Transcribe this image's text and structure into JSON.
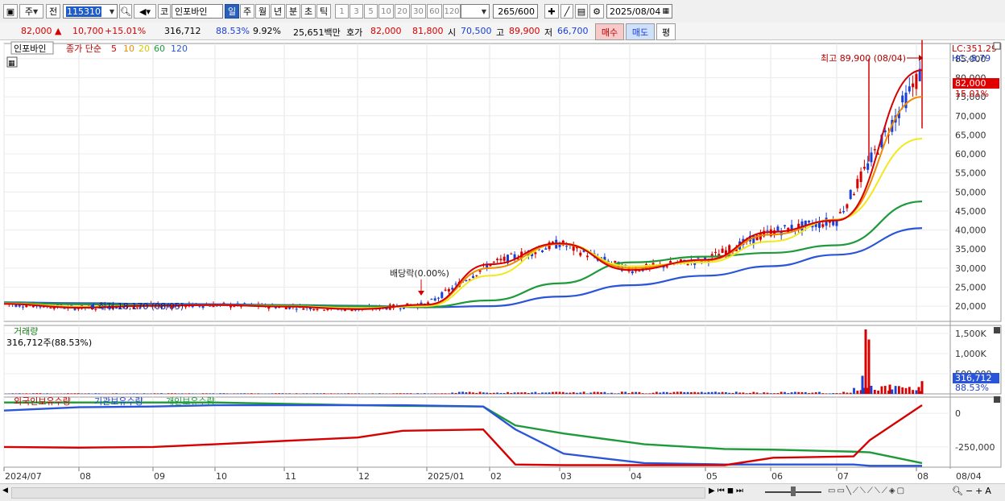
{
  "toolbar": {
    "market": "주",
    "prev": "전",
    "code": "115310",
    "market_type": "코",
    "stock_name": "인포바인",
    "period_tabs": [
      "일",
      "주",
      "월",
      "년",
      "분",
      "초",
      "틱"
    ],
    "active_period": "일",
    "intervals": [
      "1",
      "3",
      "5",
      "10",
      "20",
      "30",
      "60",
      "120"
    ],
    "count": "265",
    "count_total": "/600",
    "date": "2025/08/04"
  },
  "quote": {
    "price": "82,000",
    "change": "10,700",
    "change_pct": "+15.01%",
    "volume": "316,712",
    "volume_ratio": "88.53%",
    "turnover": "9.92%",
    "amount": "25,651백만",
    "bid_label": "호가",
    "bid1": "82,000",
    "bid2": "81,800",
    "open_label": "시",
    "open": "70,500",
    "high_label": "고",
    "high": "89,900",
    "low_label": "저",
    "low": "66,700",
    "buy": "매수",
    "sell": "매도",
    "eval": "평"
  },
  "price_panel": {
    "legend_name": "인포바인",
    "ma_label": "종가 단순",
    "ma_periods": [
      "5",
      "10",
      "20",
      "60",
      "120"
    ],
    "lc": "LC:351.29",
    "hc": "HC:-8.79",
    "high_annot": "최고 89,900 (08/04)",
    "low_annot": "최저 18,170 (08/05)",
    "dividend_annot": "배당락(0.00%)",
    "price_tag": "82,000",
    "pct_tag": "15.01%"
  },
  "volume_panel": {
    "title": "거래량",
    "current": "316,712주(88.53%)",
    "tag_value": "316,712",
    "tag_pct": "88.53%"
  },
  "holding_panel": {
    "labels": [
      "외국인보유수량",
      "기관보유수량",
      "개인보유수량"
    ]
  },
  "colors": {
    "up": "#d60000",
    "down": "#1a3fd6",
    "ma5": "#d60000",
    "ma10": "#f08a00",
    "ma20": "#f2e81e",
    "ma60": "#1e9a3a",
    "ma120": "#2a55d8"
  },
  "chart_data": [
    {
      "type": "line",
      "panel": "price",
      "x_ticks": [
        "2024/07",
        "08",
        "09",
        "10",
        "11",
        "12",
        "2025/01",
        "02",
        "03",
        "04",
        "05",
        "06",
        "07",
        "08",
        "08/04"
      ],
      "y_ticks": [
        20000,
        25000,
        30000,
        35000,
        40000,
        45000,
        50000,
        55000,
        60000,
        65000,
        70000,
        75000,
        80000,
        85000
      ],
      "ylim": [
        16000,
        89000
      ],
      "x": [
        "2024/07",
        "2024/08",
        "2024/09",
        "2024/10",
        "2024/11",
        "2024/12",
        "2025/01",
        "2025/02",
        "2025/03",
        "2025/04",
        "2025/05",
        "2025/06",
        "2025/07",
        "2025/08"
      ],
      "series": [
        {
          "name": "5",
          "values": [
            20600,
            19600,
            20100,
            20300,
            19900,
            19200,
            20400,
            31000,
            36500,
            29500,
            32200,
            39500,
            42500,
            82000
          ]
        },
        {
          "name": "10",
          "values": [
            20600,
            19700,
            20100,
            20300,
            19900,
            19300,
            20300,
            30000,
            36300,
            30000,
            32000,
            38800,
            42700,
            75000
          ]
        },
        {
          "name": "20",
          "values": [
            20700,
            19900,
            20100,
            20300,
            20000,
            19500,
            20000,
            28000,
            36500,
            30500,
            31500,
            37000,
            42800,
            64000
          ]
        },
        {
          "name": "60",
          "values": [
            20900,
            20500,
            20300,
            20300,
            20200,
            20000,
            19800,
            21500,
            26000,
            31500,
            33000,
            34000,
            36000,
            47500
          ]
        },
        {
          "name": "120",
          "values": [
            21000,
            20800,
            20600,
            20500,
            20300,
            20100,
            19700,
            20000,
            22500,
            25500,
            28000,
            30500,
            33500,
            40500
          ]
        }
      ]
    },
    {
      "type": "bar",
      "panel": "volume",
      "y_ticks": [
        "500,000",
        "1,000K",
        "1,500K"
      ],
      "ylim": [
        0,
        1700000
      ]
    },
    {
      "type": "line",
      "panel": "holdings",
      "y_ticks": [
        "0",
        "-250,000"
      ],
      "ylim": [
        -400000,
        120000
      ],
      "series": [
        {
          "name": "외국인보유수량",
          "values": [
            -250000,
            -255000,
            -250000,
            -230000,
            -205000,
            -180000,
            -130000,
            -120000,
            -380000,
            -385000,
            -385000,
            -385000,
            -330000,
            -320000,
            -200000,
            60000
          ]
        },
        {
          "name": "기관보유수량",
          "values": [
            20000,
            45000,
            50000,
            60000,
            60000,
            60000,
            60000,
            50000,
            -120000,
            -300000,
            -370000,
            -380000,
            -380000,
            -380000,
            -390000,
            -390000
          ]
        },
        {
          "name": "개인보유수량",
          "values": [
            80000,
            80000,
            80000,
            80000,
            70000,
            60000,
            55000,
            50000,
            -90000,
            -150000,
            -230000,
            -265000,
            -270000,
            -285000,
            -290000,
            -370000
          ]
        }
      ]
    }
  ]
}
